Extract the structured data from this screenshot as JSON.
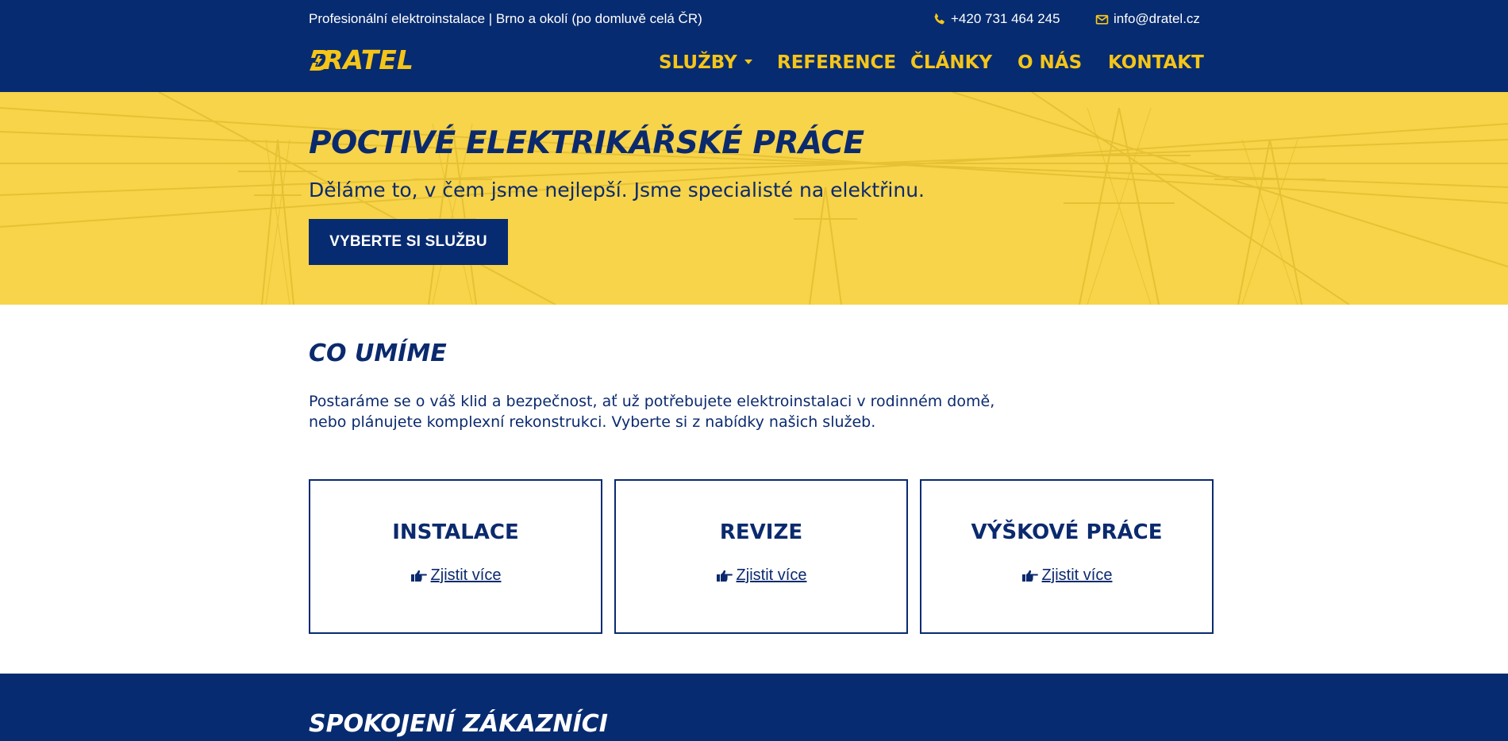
{
  "topbar": {
    "tagline": "Profesionální elektroinstalace | Brno a okolí (po domluvě celá ČR)",
    "phone": "+420 731 464 245",
    "email": "info@dratel.cz"
  },
  "logo": {
    "text": "RATEL",
    "brand": "DRATEL"
  },
  "nav": {
    "items": [
      {
        "label": "SLUŽBY",
        "has_dropdown": true
      },
      {
        "label": "REFERENCE"
      },
      {
        "label": "ČLÁNKY"
      },
      {
        "label": "O NÁS"
      },
      {
        "label": "KONTAKT"
      }
    ]
  },
  "hero": {
    "title": "POCTIVÉ ELEKTRIKÁŘSKÉ PRÁCE",
    "subtitle": "Děláme to, v čem jsme nejlepší. Jsme specialisté na elektřinu.",
    "cta_label": "VYBERTE SI SLUŽBU"
  },
  "services": {
    "title": "CO UMÍME",
    "intro_line1": "Postaráme se o váš klid a bezpečnost, ať už potřebujete elektroinstalaci v rodinném domě,",
    "intro_line2": "nebo plánujete komplexní rekonstrukci. Vyberte si z nabídky našich služeb.",
    "cards": [
      {
        "title": "INSTALACE",
        "link": "Zjistit více"
      },
      {
        "title": "REVIZE",
        "link": "Zjistit více"
      },
      {
        "title": "VÝŠKOVÉ PRÁCE",
        "link": "Zjistit více"
      }
    ]
  },
  "customers": {
    "title": "SPOKOJENÍ ZÁKAZNÍCI"
  },
  "colors": {
    "brand_blue": "#072b70",
    "brand_yellow": "#f5c518",
    "hero_yellow": "#f7d44a",
    "text_blue": "#0b2a6e"
  },
  "icons": [
    "phone-icon",
    "envelope-icon",
    "dropdown-caret-icon",
    "pointing-hand-icon"
  ]
}
